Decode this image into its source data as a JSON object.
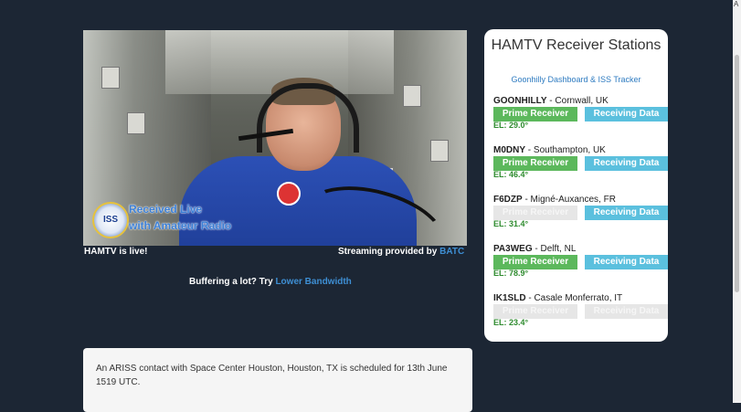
{
  "video": {
    "overlay_line1": "Received Live",
    "overlay_line2": "with Amateur Radio",
    "logo_text": "ISS"
  },
  "live_label": "HAMTV is live!",
  "streaming": {
    "prefix": "Streaming provided by ",
    "link": "BATC"
  },
  "buffering": {
    "prefix": "Buffering a lot? Try ",
    "link": "Lower Bandwidth"
  },
  "panel": {
    "title": "HAMTV Receiver Stations",
    "subtitle": "Goonhilly Dashboard & ISS Tracker",
    "prime_label": "Prime Receiver",
    "data_label": "Receiving Data",
    "stations": [
      {
        "callsign": "GOONHILLY",
        "location": " - Cornwall, UK",
        "elevation": "EL: 29.0°",
        "prime": true,
        "receiving": true
      },
      {
        "callsign": "M0DNY",
        "location": " - Southampton, UK",
        "elevation": "EL: 46.4°",
        "prime": true,
        "receiving": true
      },
      {
        "callsign": "F6DZP",
        "location": " - Migné-Auxances, FR",
        "elevation": "EL: 31.4°",
        "prime": false,
        "receiving": true
      },
      {
        "callsign": "PA3WEG",
        "location": " - Delft, NL",
        "elevation": "EL: 78.9°",
        "prime": true,
        "receiving": true
      },
      {
        "callsign": "IK1SLD",
        "location": " - Casale Monferrato, IT",
        "elevation": "EL: 23.4°",
        "prime": false,
        "receiving": false
      }
    ]
  },
  "notice": "An ARISS contact with Space Center Houston, Houston, TX is scheduled for 13th June 1519 UTC.",
  "corner_mark": "A"
}
